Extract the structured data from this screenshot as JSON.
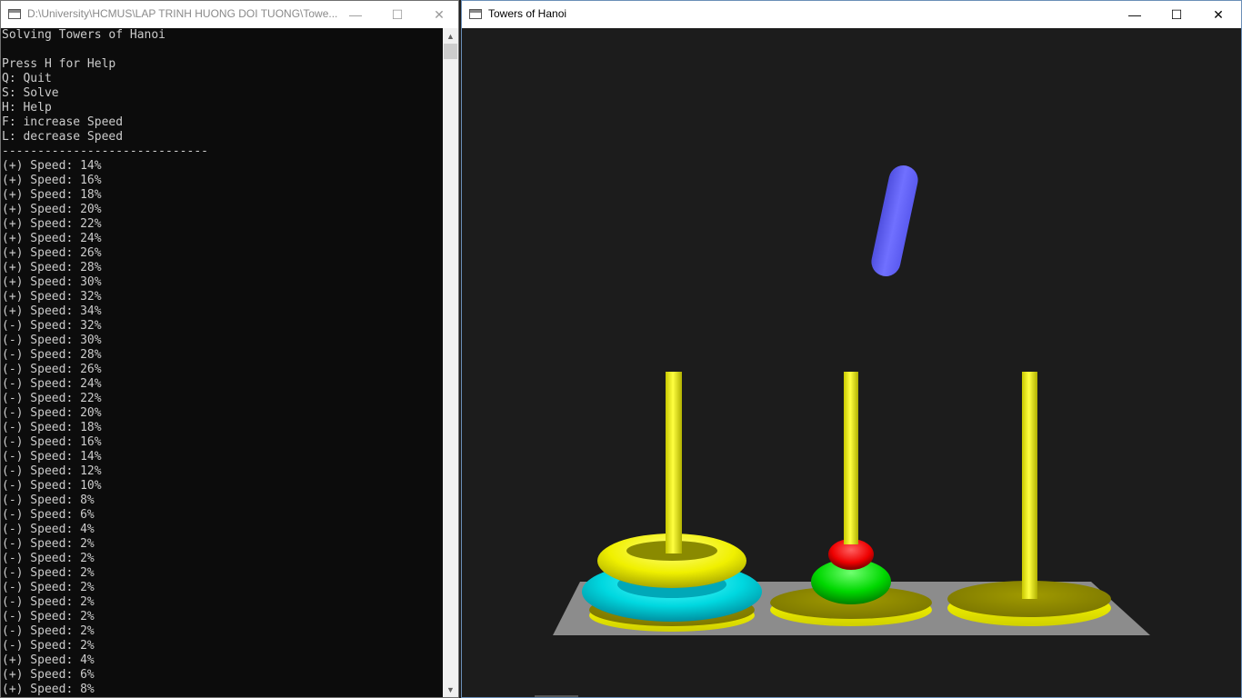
{
  "console_window": {
    "title": "D:\\University\\HCMUS\\LAP TRINH HUONG DOI TUONG\\Towe...",
    "lines": [
      "Solving Towers of Hanoi",
      "",
      "Press H for Help",
      "Q: Quit",
      "S: Solve",
      "H: Help",
      "F: increase Speed",
      "L: decrease Speed",
      "-----------------------------",
      "(+) Speed: 14%",
      "(+) Speed: 16%",
      "(+) Speed: 18%",
      "(+) Speed: 20%",
      "(+) Speed: 22%",
      "(+) Speed: 24%",
      "(+) Speed: 26%",
      "(+) Speed: 28%",
      "(+) Speed: 30%",
      "(+) Speed: 32%",
      "(+) Speed: 34%",
      "(-) Speed: 32%",
      "(-) Speed: 30%",
      "(-) Speed: 28%",
      "(-) Speed: 26%",
      "(-) Speed: 24%",
      "(-) Speed: 22%",
      "(-) Speed: 20%",
      "(-) Speed: 18%",
      "(-) Speed: 16%",
      "(-) Speed: 14%",
      "(-) Speed: 12%",
      "(-) Speed: 10%",
      "(-) Speed: 8%",
      "(-) Speed: 6%",
      "(-) Speed: 4%",
      "(-) Speed: 2%",
      "(-) Speed: 2%",
      "(-) Speed: 2%",
      "(-) Speed: 2%",
      "(-) Speed: 2%",
      "(-) Speed: 2%",
      "(-) Speed: 2%",
      "(-) Speed: 2%",
      "(+) Speed: 4%",
      "(+) Speed: 6%",
      "(+) Speed: 8%"
    ]
  },
  "gl_window": {
    "title": "Towers of Hanoi"
  },
  "controls": {
    "minimize": "—",
    "maximize": "☐",
    "close": "✕",
    "scroll_up": "▲",
    "scroll_down": "▼"
  },
  "colors": {
    "peg": "#ffff00",
    "base": "#8c8c8c",
    "disk_cyan": "#00dcdc",
    "disk_yellow": "#ffff00",
    "disk_green": "#00e000",
    "disk_red": "#ff0000",
    "disk_moving": "#6a6aff"
  }
}
